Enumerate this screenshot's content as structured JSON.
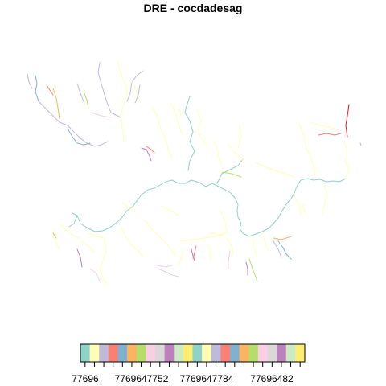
{
  "title": "DRE - cocdadesag",
  "legend": {
    "colors": [
      "#8DD3C7",
      "#FFFFB3",
      "#BEBADA",
      "#FB8072",
      "#80B1D3",
      "#FDB462",
      "#B3DE69",
      "#FCCDE5",
      "#D9D9D9",
      "#BC80BD",
      "#CCEBC5",
      "#FFED6F",
      "#8DD3C7",
      "#FFFFB3",
      "#BEBADA",
      "#FB8072",
      "#80B1D3",
      "#FDB462",
      "#B3DE69",
      "#FCCDE5",
      "#D9D9D9",
      "#BC80BD",
      "#CCEBC5",
      "#FFED6F"
    ],
    "tick_labels": [
      "77696",
      "7769647752",
      "7769647784",
      "77696482"
    ]
  },
  "network_colors": {
    "main_stem": "#8DD3C7",
    "palette": [
      "#FFFFB3",
      "#BEBADA",
      "#FB8072",
      "#80B1D3",
      "#FDB462",
      "#B3DE69",
      "#FCCDE5",
      "#D9D9D9",
      "#BC80BD",
      "#CCEBC5",
      "#FFED6F",
      "#E41A1C"
    ]
  }
}
